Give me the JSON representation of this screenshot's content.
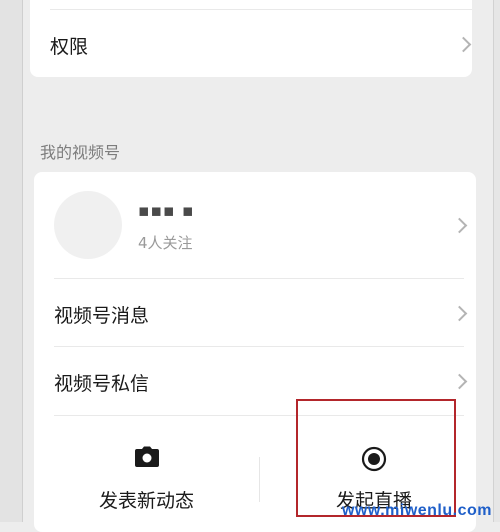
{
  "top_card": {
    "permissions_label": "权限"
  },
  "section": {
    "title": "我的视频号"
  },
  "profile": {
    "name": "▪▪▪ ▪",
    "follow_count": "4人关注"
  },
  "rows": [
    {
      "label": "视频号消息"
    },
    {
      "label": "视频号私信"
    }
  ],
  "actions": {
    "post_label": "发表新动态",
    "live_label": "发起直播",
    "post_icon": "camera-icon",
    "live_icon": "record-icon"
  },
  "colors": {
    "highlight": "#b3262b",
    "watermark": "#1f5fc9"
  },
  "watermark": "www.miwenlu.com"
}
